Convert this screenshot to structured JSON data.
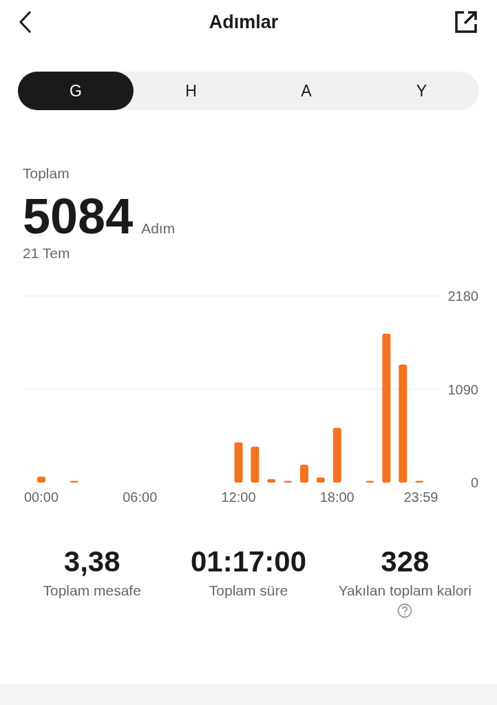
{
  "header": {
    "title": "Adımlar"
  },
  "tabs": [
    {
      "label": "G",
      "selected": true
    },
    {
      "label": "H",
      "selected": false
    },
    {
      "label": "A",
      "selected": false
    },
    {
      "label": "Y",
      "selected": false
    }
  ],
  "summary": {
    "label": "Toplam",
    "value": "5084",
    "unit": "Adım",
    "date": "21 Tem"
  },
  "chart_data": {
    "type": "bar",
    "x": [
      0,
      2,
      12,
      13,
      14,
      15,
      16,
      17,
      18,
      20,
      21,
      22,
      23
    ],
    "series": [
      {
        "color": "#f47320",
        "values": [
          70,
          20,
          470,
          420,
          40,
          20,
          210,
          60,
          640,
          20,
          1740,
          1380,
          20
        ]
      }
    ],
    "xlim": [
      0,
      23.98
    ],
    "ylim": [
      0,
      2180
    ],
    "yticks": [
      0,
      1090,
      2180
    ],
    "xticks": [
      {
        "value": 0,
        "label": "00:00"
      },
      {
        "value": 6,
        "label": "06:00"
      },
      {
        "value": 12,
        "label": "12:00"
      },
      {
        "value": 18,
        "label": "18:00"
      },
      {
        "value": 23.98,
        "label": "23:59"
      }
    ]
  },
  "stats": [
    {
      "value": "3,38",
      "label": "Toplam mesafe",
      "help": false
    },
    {
      "value": "01:17:00",
      "label": "Toplam süre",
      "help": false
    },
    {
      "value": "328",
      "label": "Yakılan toplam kalori",
      "help": true
    }
  ]
}
